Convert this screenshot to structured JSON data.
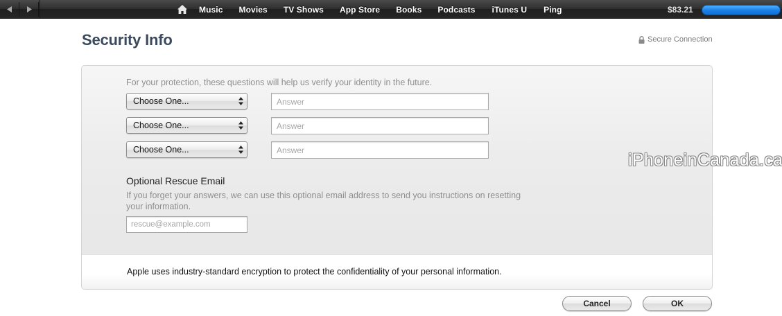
{
  "nav": {
    "back_icon": "chevron-left-icon",
    "forward_icon": "chevron-right-icon",
    "home_icon": "home-icon",
    "links": [
      "Music",
      "Movies",
      "TV Shows",
      "App Store",
      "Books",
      "Podcasts",
      "iTunes U",
      "Ping"
    ],
    "balance": "$83.21",
    "accent": "#1a7fe6"
  },
  "page": {
    "title": "Security Info",
    "secure_label": "Secure Connection",
    "lock_icon": "lock-icon"
  },
  "security": {
    "intro": "For your protection, these questions will help us verify your identity in the future.",
    "questions": [
      {
        "select": "Choose One...",
        "answer_placeholder": "Answer"
      },
      {
        "select": "Choose One...",
        "answer_placeholder": "Answer"
      },
      {
        "select": "Choose One...",
        "answer_placeholder": "Answer"
      }
    ]
  },
  "rescue": {
    "title": "Optional Rescue Email",
    "description": "If you forget your answers, we can use this optional email address to send you instructions on resetting your information.",
    "email_placeholder": "rescue@example.com"
  },
  "footer": {
    "encryption_note": "Apple uses industry-standard encryption to protect the confidentiality of your personal information."
  },
  "buttons": {
    "cancel": "Cancel",
    "ok": "OK"
  },
  "watermark": "iPhoneinCanada.ca"
}
